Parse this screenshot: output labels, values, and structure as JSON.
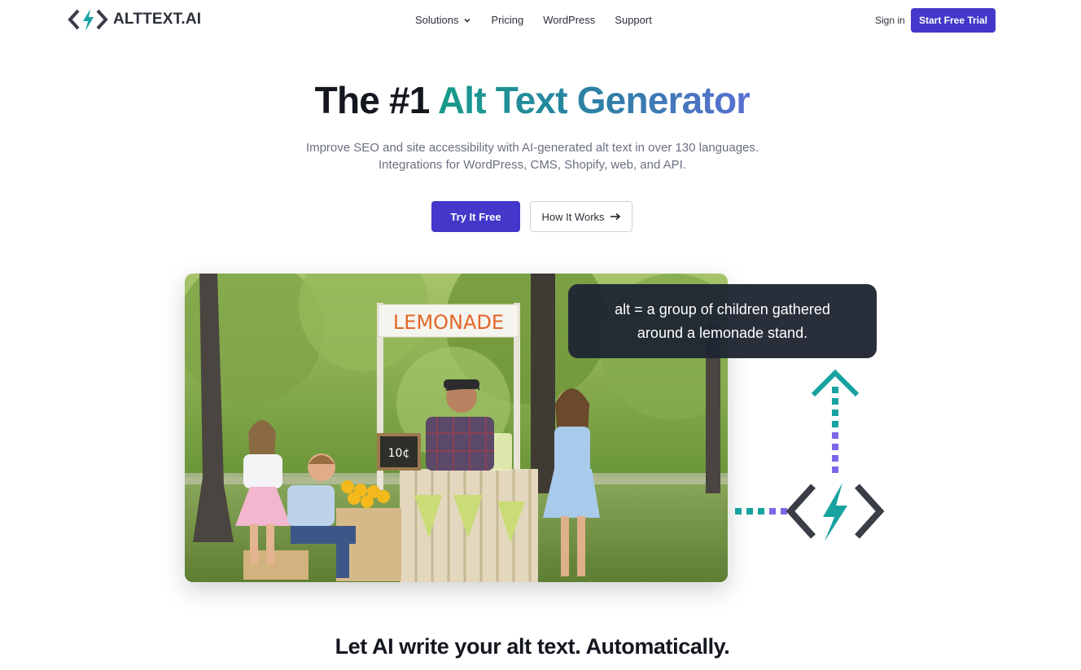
{
  "brand": {
    "name": "ALTTEXT.AI"
  },
  "nav": {
    "links": [
      {
        "label": "Solutions",
        "has_dropdown": true
      },
      {
        "label": "Pricing"
      },
      {
        "label": "WordPress"
      },
      {
        "label": "Support"
      }
    ],
    "signin_label": "Sign in",
    "trial_label": "Start Free Trial"
  },
  "hero": {
    "title_plain": "The #1 ",
    "title_highlight": "Alt Text Generator",
    "subtitle_line1": "Improve SEO and site accessibility with AI-generated alt text in over 130 languages.",
    "subtitle_line2": "Integrations for WordPress, CMS, Shopify, web, and API.",
    "primary_cta": "Try It Free",
    "secondary_cta": "How It Works",
    "secondary_cta_icon": "arrow-right-icon"
  },
  "demo": {
    "sign_text": "LEMONADE",
    "price_sign": "10¢",
    "alt_text": "alt = a group of children gathered around a lemonade stand."
  },
  "section": {
    "title": "Let AI write your alt text. Automatically."
  },
  "colors": {
    "primary": "#4338ca",
    "gradient_start": "#169b8a",
    "gradient_end": "#5a6fd2",
    "teal": "#17a2a0",
    "purple": "#7b68e8",
    "dark_card": "#1f2632"
  }
}
